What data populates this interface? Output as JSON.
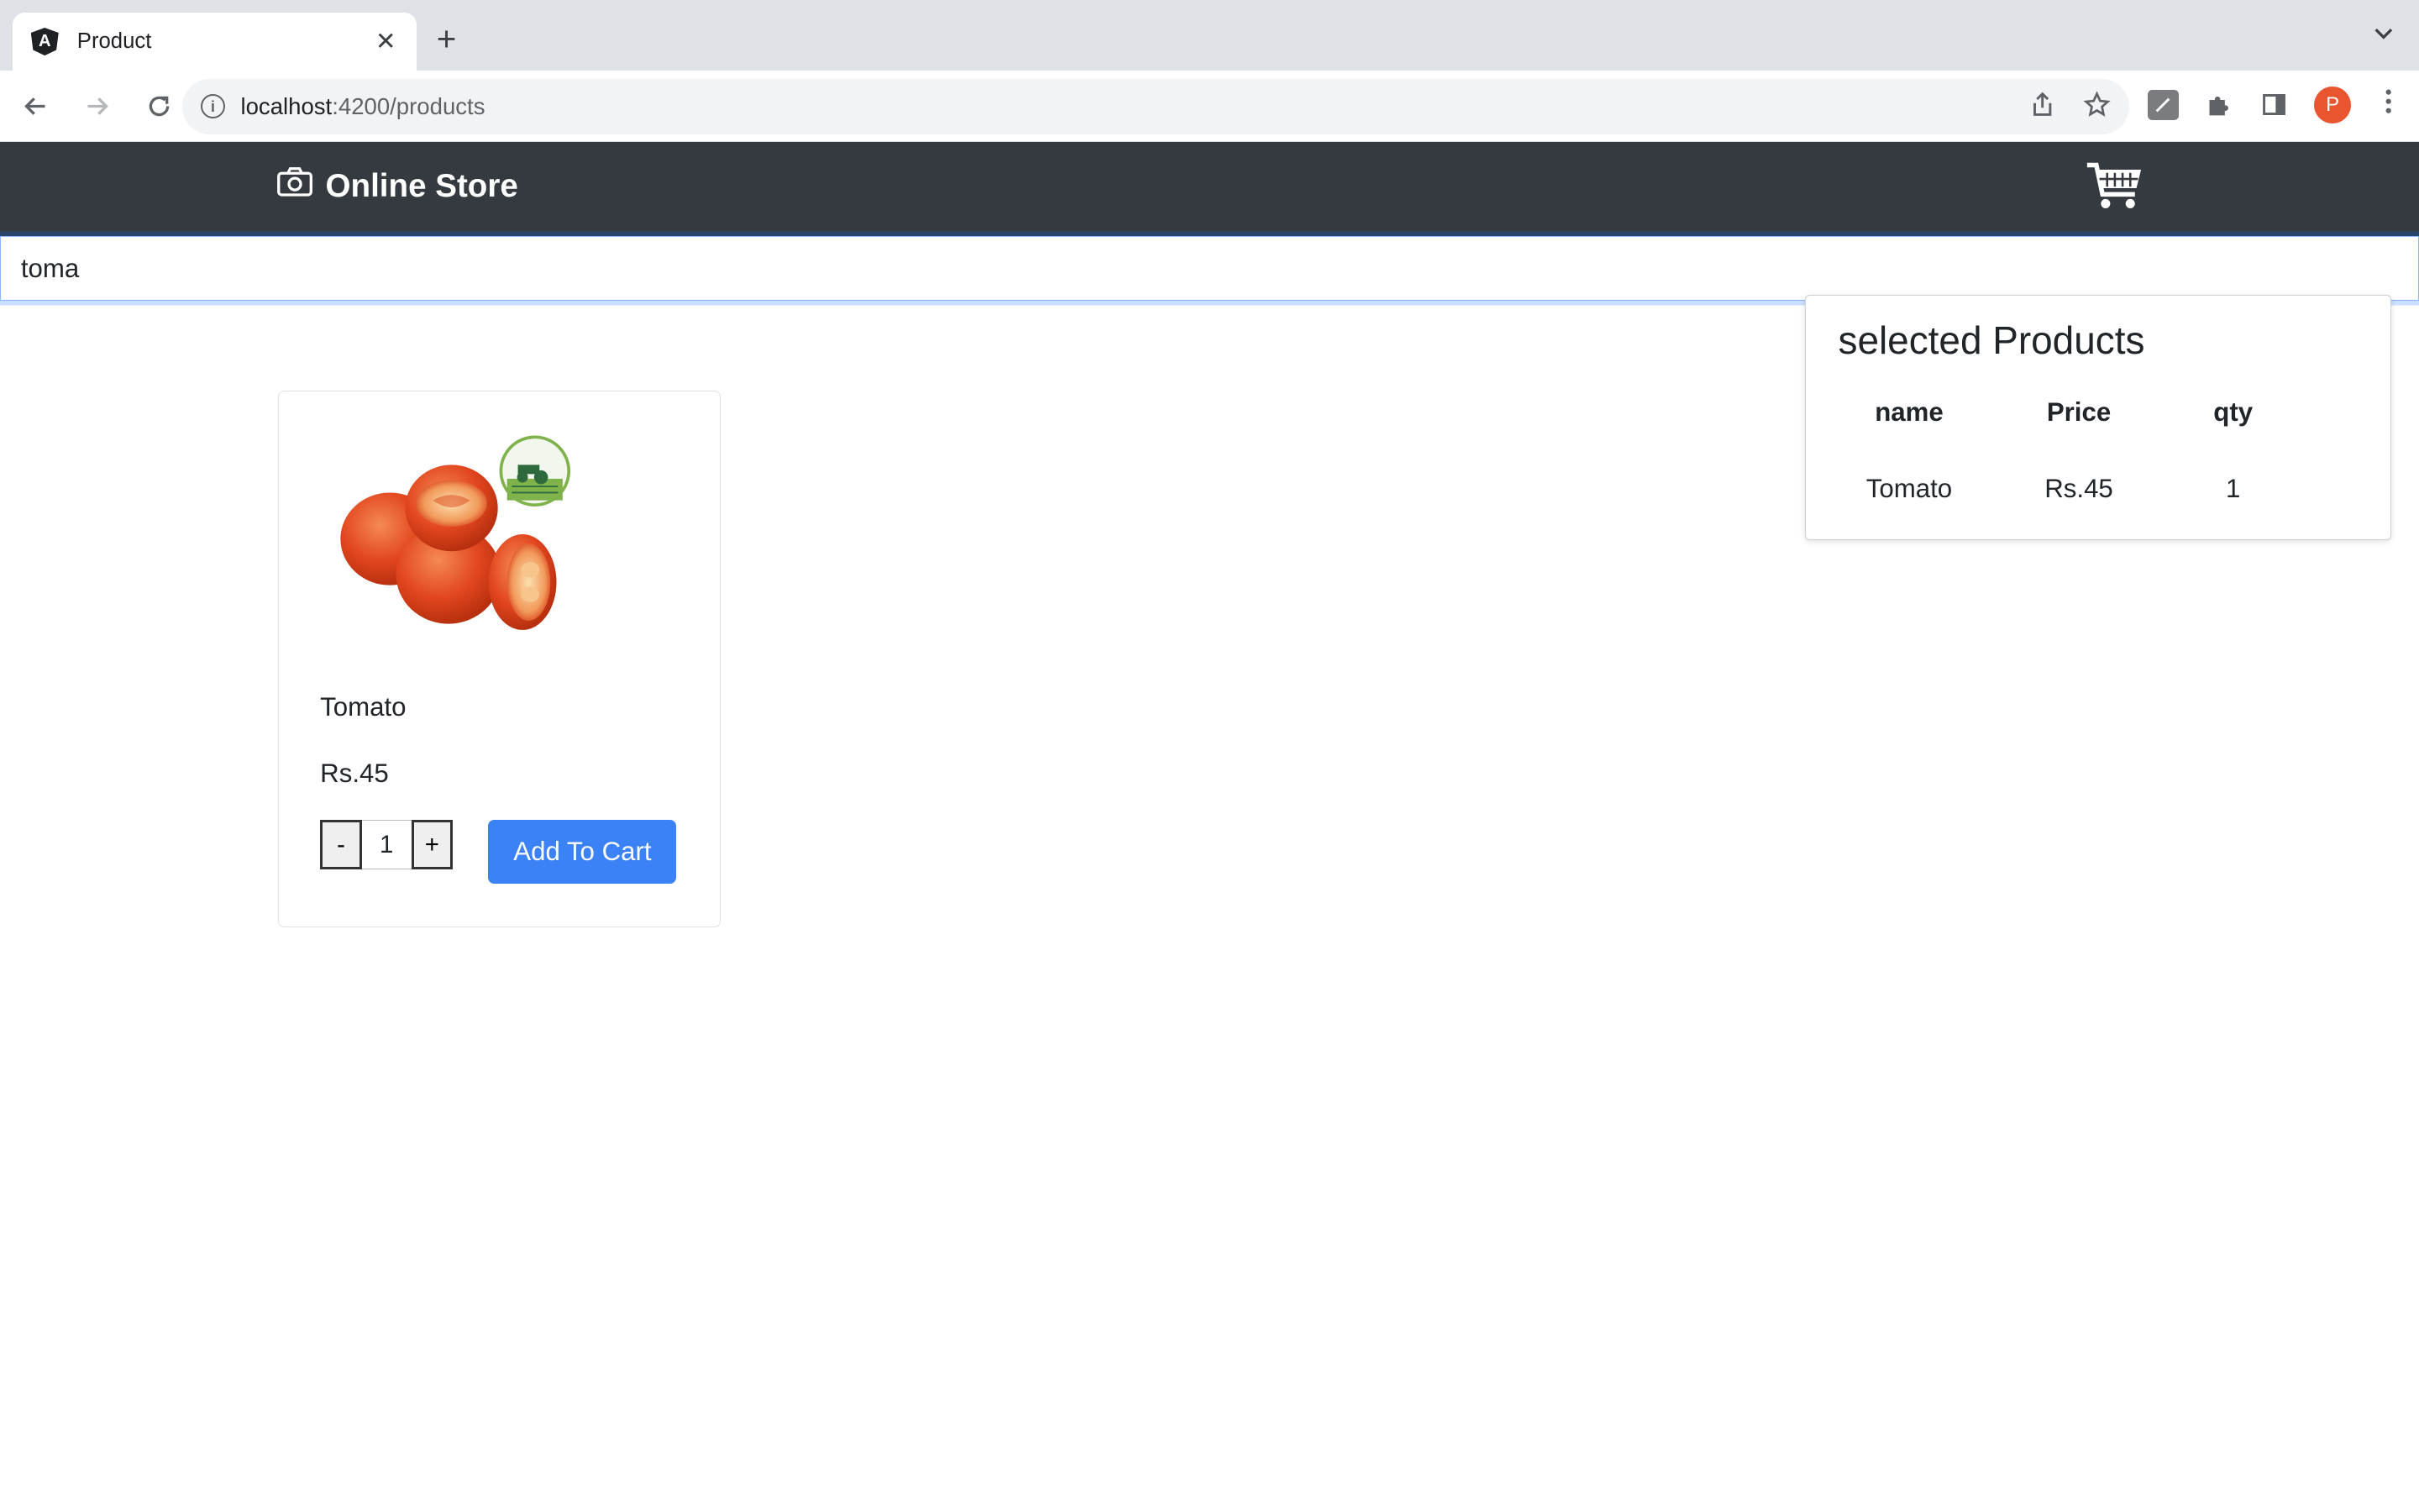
{
  "browser": {
    "tab_title": "Product",
    "favicon_letter": "A",
    "new_tab_glyph": "+",
    "tab_close_glyph": "✕",
    "url_host": "localhost",
    "url_path": ":4200/products",
    "profile_initial": "P"
  },
  "app": {
    "brand": "Online Store",
    "icons": {
      "brand": "camera-icon",
      "cart": "cart-icon"
    },
    "colors": {
      "navbar": "#343a40",
      "primary_button": "#3b82f6"
    }
  },
  "search": {
    "value": "toma"
  },
  "products": [
    {
      "name": "Tomato",
      "price": "Rs.45",
      "quantity": "1",
      "decrement_label": "-",
      "increment_label": "+",
      "add_label": "Add To Cart"
    }
  ],
  "cart": {
    "title": "selected Products",
    "columns": [
      "name",
      "Price",
      "qty"
    ],
    "rows": [
      [
        "Tomato",
        "Rs.45",
        "1"
      ]
    ]
  }
}
